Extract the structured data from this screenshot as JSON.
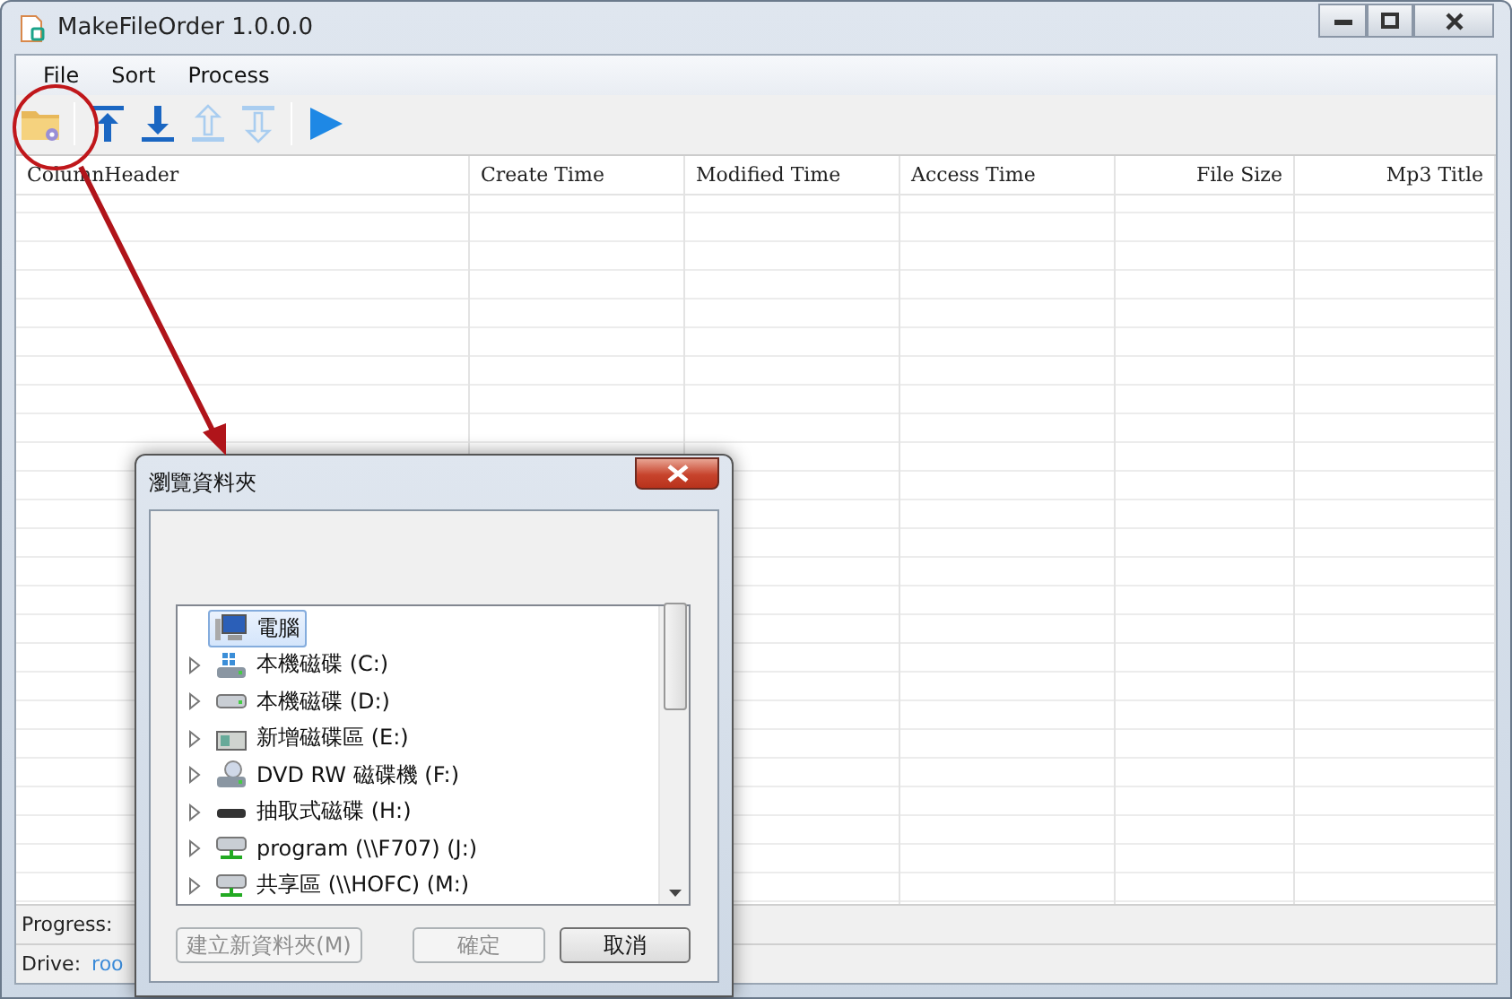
{
  "window": {
    "title": "MakeFileOrder 1.0.0.0"
  },
  "menu": [
    "File",
    "Sort",
    "Process"
  ],
  "toolbar": [
    {
      "kind": "folder",
      "disabled": false
    },
    {
      "kind": "sep"
    },
    {
      "kind": "top",
      "disabled": false
    },
    {
      "kind": "bottom",
      "disabled": false
    },
    {
      "kind": "up",
      "disabled": true
    },
    {
      "kind": "down",
      "disabled": true
    },
    {
      "kind": "sep"
    },
    {
      "kind": "play",
      "disabled": false
    }
  ],
  "table": {
    "columns": [
      {
        "label": "ColumnHeader"
      },
      {
        "label": "Create Time"
      },
      {
        "label": "Modified Time"
      },
      {
        "label": "Access Time"
      },
      {
        "label": "File Size"
      },
      {
        "label": "Mp3 Title"
      }
    ]
  },
  "status_bar": [
    {
      "label": "Progress:"
    },
    {
      "label": "Drive:",
      "value": "roo"
    }
  ],
  "dialog": {
    "title": "瀏覽資料夾",
    "tree": {
      "label": "電腦",
      "kind": "computer",
      "selected": true,
      "children": [
        {
          "label": "本機磁碟 (C:)",
          "kind": "system",
          "selected": false
        },
        {
          "label": "本機磁碟 (D:)",
          "kind": "disk",
          "selected": false
        },
        {
          "label": "新增磁碟區 (E:)",
          "kind": "volume",
          "selected": false
        },
        {
          "label": "DVD RW 磁碟機 (F:)",
          "kind": "dvd",
          "selected": false
        },
        {
          "label": "抽取式磁碟 (H:)",
          "kind": "removable",
          "selected": false
        },
        {
          "label": "program (\\\\F707) (J:)",
          "kind": "network",
          "selected": false
        },
        {
          "label": "共享區 (\\\\HOFC) (M:)",
          "kind": "network",
          "selected": false
        }
      ]
    },
    "buttons": [
      {
        "label": "建立新資料夾(M)",
        "disabled": true
      },
      {
        "label": "確定",
        "disabled": true
      },
      {
        "label": "取消",
        "disabled": false
      }
    ]
  }
}
